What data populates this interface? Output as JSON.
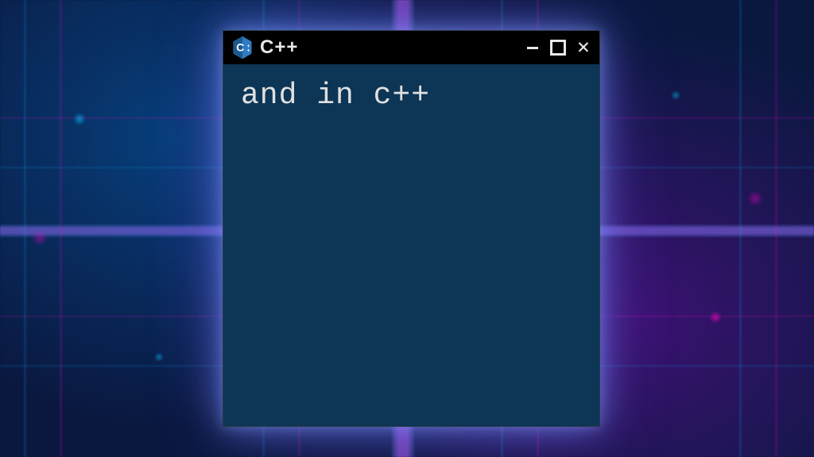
{
  "window": {
    "title": "C++",
    "icon": "cpp-icon"
  },
  "content": {
    "text": "and in c++"
  },
  "colors": {
    "content_bg": "#0d3555",
    "titlebar_bg": "#000000",
    "text": "#e0e0e0"
  }
}
